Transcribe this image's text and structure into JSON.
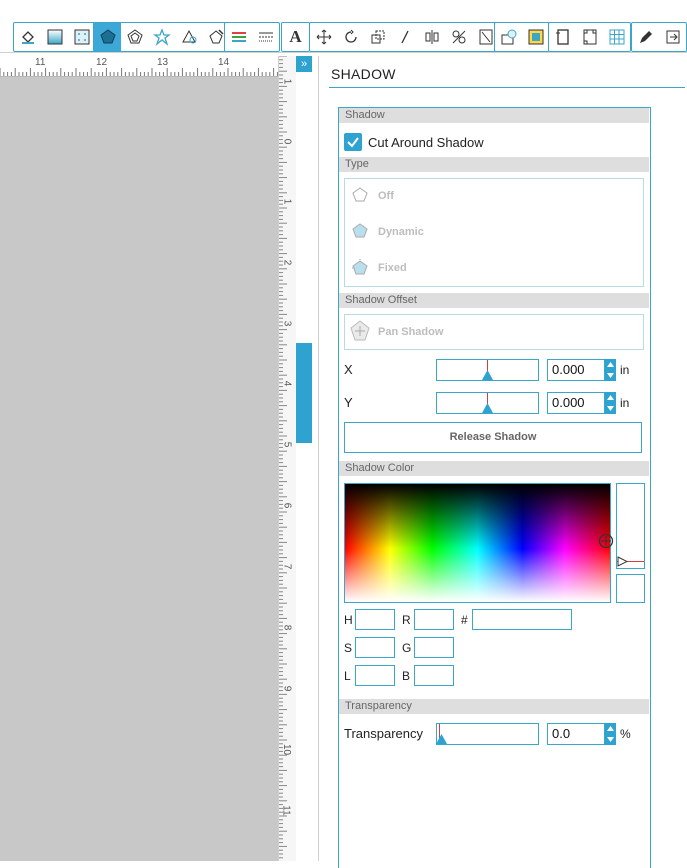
{
  "ruler": {
    "horizontal": [
      "11",
      "12",
      "13",
      "14"
    ],
    "vertical": [
      "1",
      "0",
      "1",
      "2",
      "3",
      "4",
      "5",
      "6",
      "7",
      "8",
      "9",
      "10",
      "11"
    ]
  },
  "panel": {
    "title": "SHADOW",
    "shadow_section": "Shadow",
    "cut_around_label": "Cut Around Shadow",
    "type_section": "Type",
    "type_off": "Off",
    "type_dynamic": "Dynamic",
    "type_fixed": "Fixed",
    "offset_section": "Shadow Offset",
    "pan_shadow": "Pan Shadow",
    "x_label": "X",
    "x_value": "0.000",
    "x_unit": "in",
    "y_label": "Y",
    "y_value": "0.000",
    "y_unit": "in",
    "release": "Release Shadow",
    "color_section": "Shadow Color",
    "h_label": "H",
    "s_label": "S",
    "l_label": "L",
    "r_label": "R",
    "g_label": "G",
    "b_label": "B",
    "hash_label": "#",
    "transparency_section": "Transparency",
    "transparency_label": "Transparency",
    "transparency_value": "0.0",
    "transparency_unit": "%"
  },
  "colors": {
    "accent": "#2ea3d1",
    "border": "#3aa7c8",
    "section": "#dedede"
  }
}
